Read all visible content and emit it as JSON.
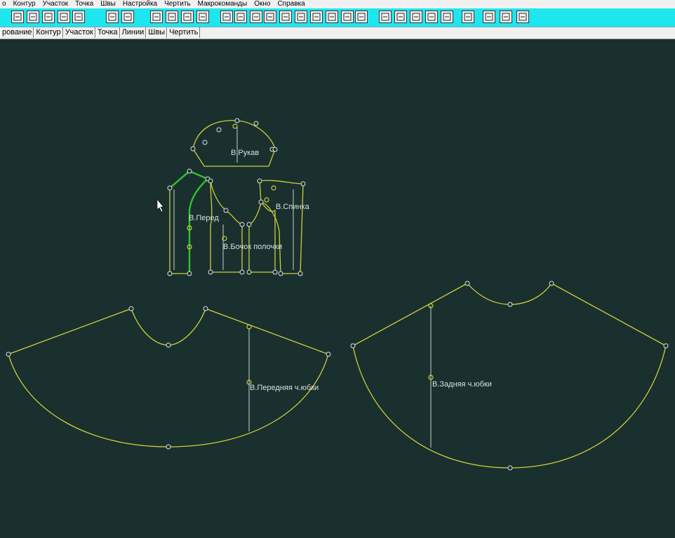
{
  "menu": [
    "о",
    "Контур",
    "Участок",
    "Точка",
    "Швы",
    "Настройка",
    "Чертить",
    "Макрокоманды",
    "Окно",
    "Справка"
  ],
  "tabs": [
    "рование",
    "Контур",
    "Участок",
    "Точка",
    "Линии",
    "Швы",
    "Чертить"
  ],
  "pieces": {
    "sleeve": "В.Рукав",
    "front": "В.Перед",
    "back": "В.Спинка",
    "side_front": "В.Бочок полочки",
    "skirt_front": "В.Передняя ч.юбки",
    "skirt_back": "В.Задняя ч.юбки"
  },
  "colors": {
    "canvas": "#19302e",
    "outline": "#cfcf3a",
    "highlight": "#2fbf2f",
    "toolbar": "#1ee6ee"
  }
}
